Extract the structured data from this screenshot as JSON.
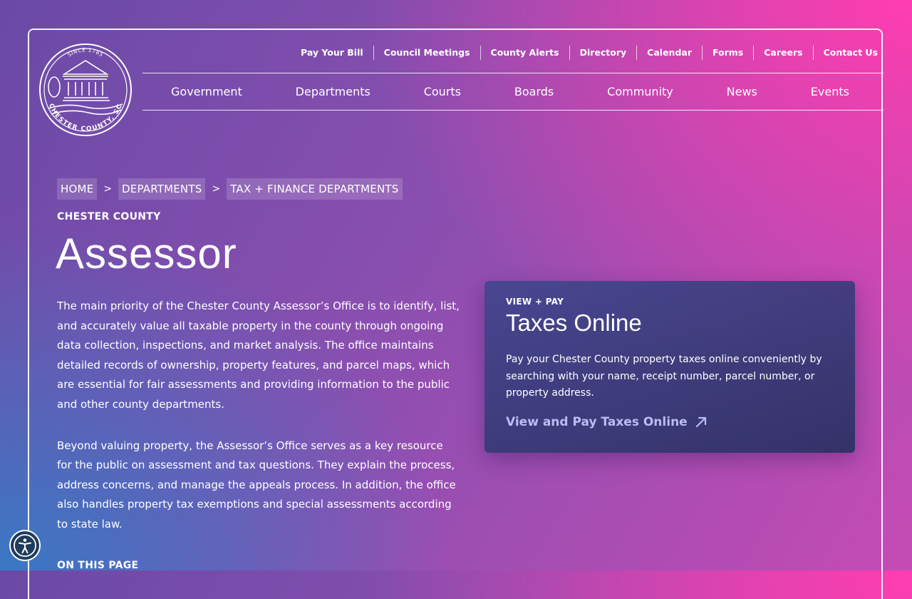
{
  "logo": {
    "top_text": "SINCE 1785",
    "bottom_text": "CHESTER COUNTY, SC"
  },
  "utility_nav": [
    {
      "label": "Pay Your Bill"
    },
    {
      "label": "Council Meetings"
    },
    {
      "label": "County Alerts"
    },
    {
      "label": "Directory"
    },
    {
      "label": "Calendar"
    },
    {
      "label": "Forms"
    },
    {
      "label": "Careers"
    },
    {
      "label": "Contact Us"
    }
  ],
  "main_nav": [
    {
      "label": "Government"
    },
    {
      "label": "Departments"
    },
    {
      "label": "Courts"
    },
    {
      "label": "Boards"
    },
    {
      "label": "Community"
    },
    {
      "label": "News"
    },
    {
      "label": "Events"
    }
  ],
  "breadcrumb": {
    "items": [
      "HOME",
      "DEPARTMENTS",
      "TAX + FINANCE DEPARTMENTS"
    ],
    "separator": ">"
  },
  "page": {
    "eyebrow": "CHESTER COUNTY",
    "title": "Assessor",
    "paragraphs": [
      "The main priority of the Chester County Assessor’s Office is to identify, list, and accurately value all taxable property in the county through ongoing data collection, inspections, and market analysis. The office maintains detailed records of ownership, property features, and parcel maps, which are essential for fair assessments and providing information to the public and other county departments.",
      "Beyond valuing property, the Assessor’s Office serves as a key resource for the public on assessment and tax questions. They explain the process, address concerns, and manage the appeals process. In addition, the office also handles property tax exemptions and special assessments according to state law."
    ],
    "on_this_page": "ON THIS PAGE"
  },
  "card": {
    "eyebrow": "VIEW + PAY",
    "title": "Taxes Online",
    "text": "Pay your Chester County property taxes online conveniently by searching with your name, receipt number, parcel number, or property address.",
    "link_label": "View and Pay Taxes Online"
  },
  "colors": {
    "link_accent": "#b9bdf3",
    "a11y_button_bg": "#1f3c5a"
  }
}
